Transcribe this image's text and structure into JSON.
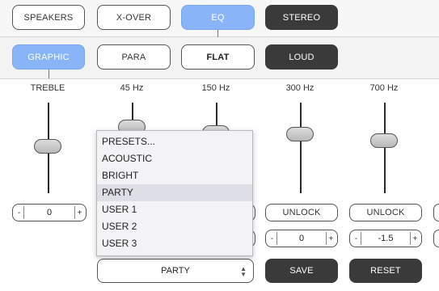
{
  "top_tabs": [
    {
      "label": "SPEAKERS",
      "state": "normal"
    },
    {
      "label": "X-OVER",
      "state": "normal"
    },
    {
      "label": "EQ",
      "state": "active"
    },
    {
      "label": "STEREO",
      "state": "dark"
    }
  ],
  "eq_modes": [
    {
      "label": "GRAPHIC",
      "state": "active"
    },
    {
      "label": "PARA",
      "state": "normal"
    },
    {
      "label": "FLAT",
      "state": "bold"
    },
    {
      "label": "LOUD",
      "state": "dark"
    }
  ],
  "bands": [
    {
      "label": "TREBLE",
      "value": "0",
      "minus": "-",
      "plus": "+"
    },
    {
      "label": "45 Hz"
    },
    {
      "label": "150 Hz"
    },
    {
      "label": "300 Hz",
      "unlock": "UNLOCK",
      "value": "0",
      "minus": "-",
      "plus": "+"
    },
    {
      "label": "700 Hz",
      "unlock": "UNLOCK",
      "value": "-1.5",
      "minus": "-",
      "plus": "+"
    }
  ],
  "presets": {
    "options": [
      "PRESETS...",
      "ACOUSTIC",
      "BRIGHT",
      "PARTY",
      "USER 1",
      "USER 2",
      "USER 3"
    ],
    "selected": "PARTY",
    "arrow_up": "▲",
    "arrow_down": "▼"
  },
  "actions": {
    "save": "SAVE",
    "reset": "RESET"
  },
  "colors": {
    "active": "#8ab4f8",
    "dark": "#3a3a3a"
  }
}
